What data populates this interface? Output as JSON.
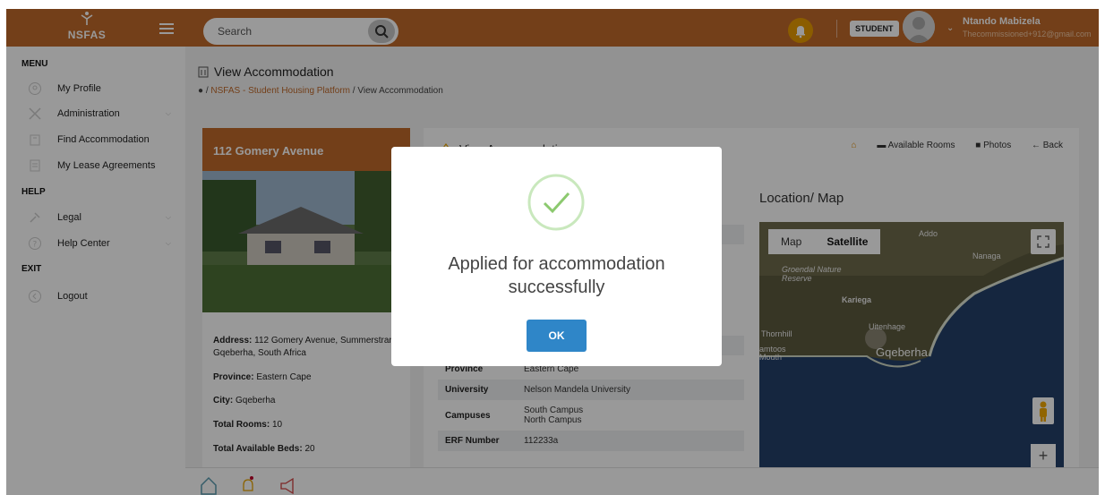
{
  "app": {
    "logo_text": "NSFAS",
    "search_placeholder": "Search",
    "role_badge": "STUDENT",
    "user_name": "Ntando Mabizela",
    "user_email": "Thecommissioned+912@gmail.com",
    "brand_color": "#c0692a"
  },
  "sidebar": {
    "sections": [
      {
        "title": "MENU"
      },
      {
        "title": "HELP"
      },
      {
        "title": "EXIT"
      }
    ],
    "items": [
      {
        "label": "My Profile",
        "icon": "user-circle-icon"
      },
      {
        "label": "Administration",
        "icon": "tools-icon",
        "has_submenu": true
      },
      {
        "label": "Find Accommodation",
        "icon": "building-icon"
      },
      {
        "label": "My Lease Agreements",
        "icon": "document-icon"
      },
      {
        "label": "Legal",
        "icon": "gavel-icon",
        "has_submenu": true
      },
      {
        "label": "Help Center",
        "icon": "question-icon",
        "has_submenu": true
      },
      {
        "label": "Logout",
        "icon": "logout-icon"
      }
    ]
  },
  "page": {
    "title": "View Accommodation",
    "breadcrumb": {
      "separator": "/",
      "link": "NSFAS - Student Housing Platform",
      "current": "View Accommodation"
    }
  },
  "property": {
    "name": "112 Gomery Avenue",
    "address_label": "Address:",
    "address": "112 Gomery Avenue, Summerstrand, Gqeberha, South Africa",
    "province_label": "Province:",
    "province": "Eastern Cape",
    "city_label": "City:",
    "city": "Gqeberha",
    "total_rooms_label": "Total Rooms:",
    "total_rooms": "10",
    "total_beds_label": "Total Available Beds:",
    "total_beds": "20"
  },
  "details": {
    "title": "View Accommodation",
    "tabs": {
      "home_icon": "home-icon",
      "rooms": "Available Rooms",
      "photos": "Photos",
      "back": "Back"
    },
    "rows": [
      {
        "key": "Province",
        "value": "Eastern Cape"
      },
      {
        "key": "University",
        "value": "Nelson Mandela University"
      },
      {
        "key": "Campuses",
        "value": "South Campus",
        "value2": "North Campus"
      },
      {
        "key": "ERF Number",
        "value": "112233a"
      }
    ]
  },
  "map": {
    "heading": "Location/ Map",
    "map_btn": "Map",
    "satellite_btn": "Satellite",
    "zoom_in": "+",
    "labels": [
      "Addo",
      "Nanaga",
      "Groendal Nature Reserve",
      "Kariega",
      "Thornhill",
      "Uitenhage",
      "Gqeberha",
      "amtoos Mouth"
    ]
  },
  "modal": {
    "message": "Applied for accommodation successfully",
    "ok_label": "OK",
    "accent": "#2f86c8"
  }
}
